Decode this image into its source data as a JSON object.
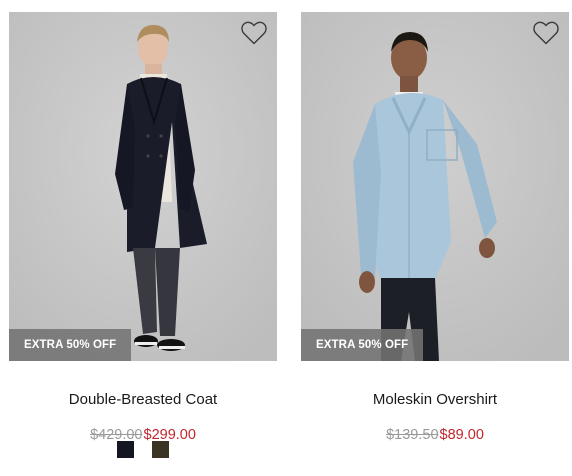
{
  "colors": {
    "sale_price": "#c0272d",
    "old_price": "#9a9a9a",
    "badge_bg": "#737373"
  },
  "products": [
    {
      "name": "Double-Breasted Coat",
      "badge": "EXTRA 50% OFF",
      "old_price": "$429.00",
      "sale_price": "$299.00",
      "wishlist_icon": "heart-outline-icon",
      "swatches": [
        "#141722",
        "#3b3323"
      ]
    },
    {
      "name": "Moleskin Overshirt",
      "badge": "EXTRA 50% OFF",
      "old_price": "$139.50",
      "sale_price": "$89.00",
      "wishlist_icon": "heart-outline-icon"
    }
  ]
}
